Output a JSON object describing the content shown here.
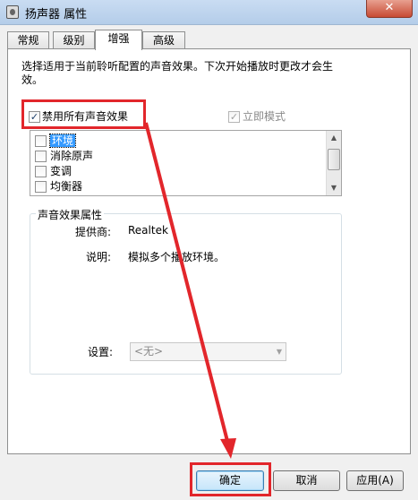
{
  "window": {
    "title": "扬声器 属性",
    "close_label": "✕"
  },
  "tabs": [
    "常规",
    "级别",
    "增强",
    "高级"
  ],
  "description": "选择适用于当前聆听配置的声音效果。下次开始播放时更改才会生效。",
  "disable_all": {
    "label": "禁用所有声音效果",
    "checked": true
  },
  "immediate_mode": {
    "label": "立即模式",
    "checked": true,
    "disabled": true
  },
  "effects_list": [
    "环境",
    "消除原声",
    "变调",
    "均衡器"
  ],
  "scrollbar": {
    "up": "▲",
    "down": "▼"
  },
  "properties": {
    "title": "声音效果属性",
    "provider_label": "提供商:",
    "provider_value": "Realtek",
    "description_label": "说明:",
    "description_value": "模拟多个播放环境。",
    "settings_label": "设置:",
    "settings_value": "<无>",
    "settings_arrow": "▼"
  },
  "buttons": {
    "ok": "确定",
    "cancel": "取消",
    "apply": "应用(A)"
  },
  "annotation": {
    "color": "#e2262b"
  }
}
